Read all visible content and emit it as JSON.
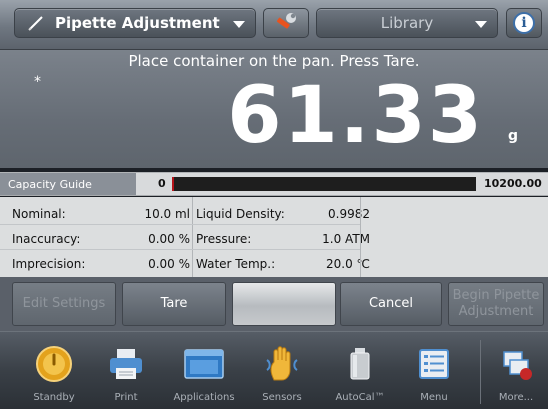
{
  "top_bar": {
    "application": "Pipette Adjustment",
    "library": "Library",
    "icons": {
      "pencil": "pencil-icon",
      "wrench": "wrench-icon",
      "info": "info-icon"
    },
    "info_glyph": "i"
  },
  "display": {
    "prompt": "Place container on the pan.  Press Tare.",
    "stable_indicator": "*",
    "weight": "61.33",
    "unit": "g"
  },
  "capacity_guide": {
    "label": "Capacity Guide",
    "min": "0",
    "max": "10200.00",
    "fill_fraction": 0.006,
    "fill_color": "#b4141a"
  },
  "info_panel": {
    "rows": [
      {
        "label": "Nominal:",
        "value": "10.0 ml",
        "label2": "Liquid Density:",
        "value2": "0.9982"
      },
      {
        "label": "Inaccuracy:",
        "value": "0.00 %",
        "label2": "Pressure:",
        "value2": "1.0 ATM"
      },
      {
        "label": "Imprecision:",
        "value": "0.00 %",
        "label2": "Water Temp.:",
        "value2": "20.0 ℃"
      }
    ]
  },
  "softkeys": {
    "edit_settings": "Edit Settings",
    "tare": "Tare",
    "cancel": "Cancel",
    "begin_adjustment_line1": "Begin Pipette",
    "begin_adjustment_line2": "Adjustment"
  },
  "iconbar": {
    "items": [
      {
        "label": "Standby",
        "icon": "standby-icon"
      },
      {
        "label": "Print",
        "icon": "printer-icon"
      },
      {
        "label": "Applications",
        "icon": "applications-icon"
      },
      {
        "label": "Sensors",
        "icon": "sensors-hand-icon"
      },
      {
        "label": "AutoCal™",
        "icon": "autocal-weight-icon"
      },
      {
        "label": "Menu",
        "icon": "menu-list-icon"
      },
      {
        "label": "More...",
        "icon": "more-icon"
      }
    ]
  }
}
